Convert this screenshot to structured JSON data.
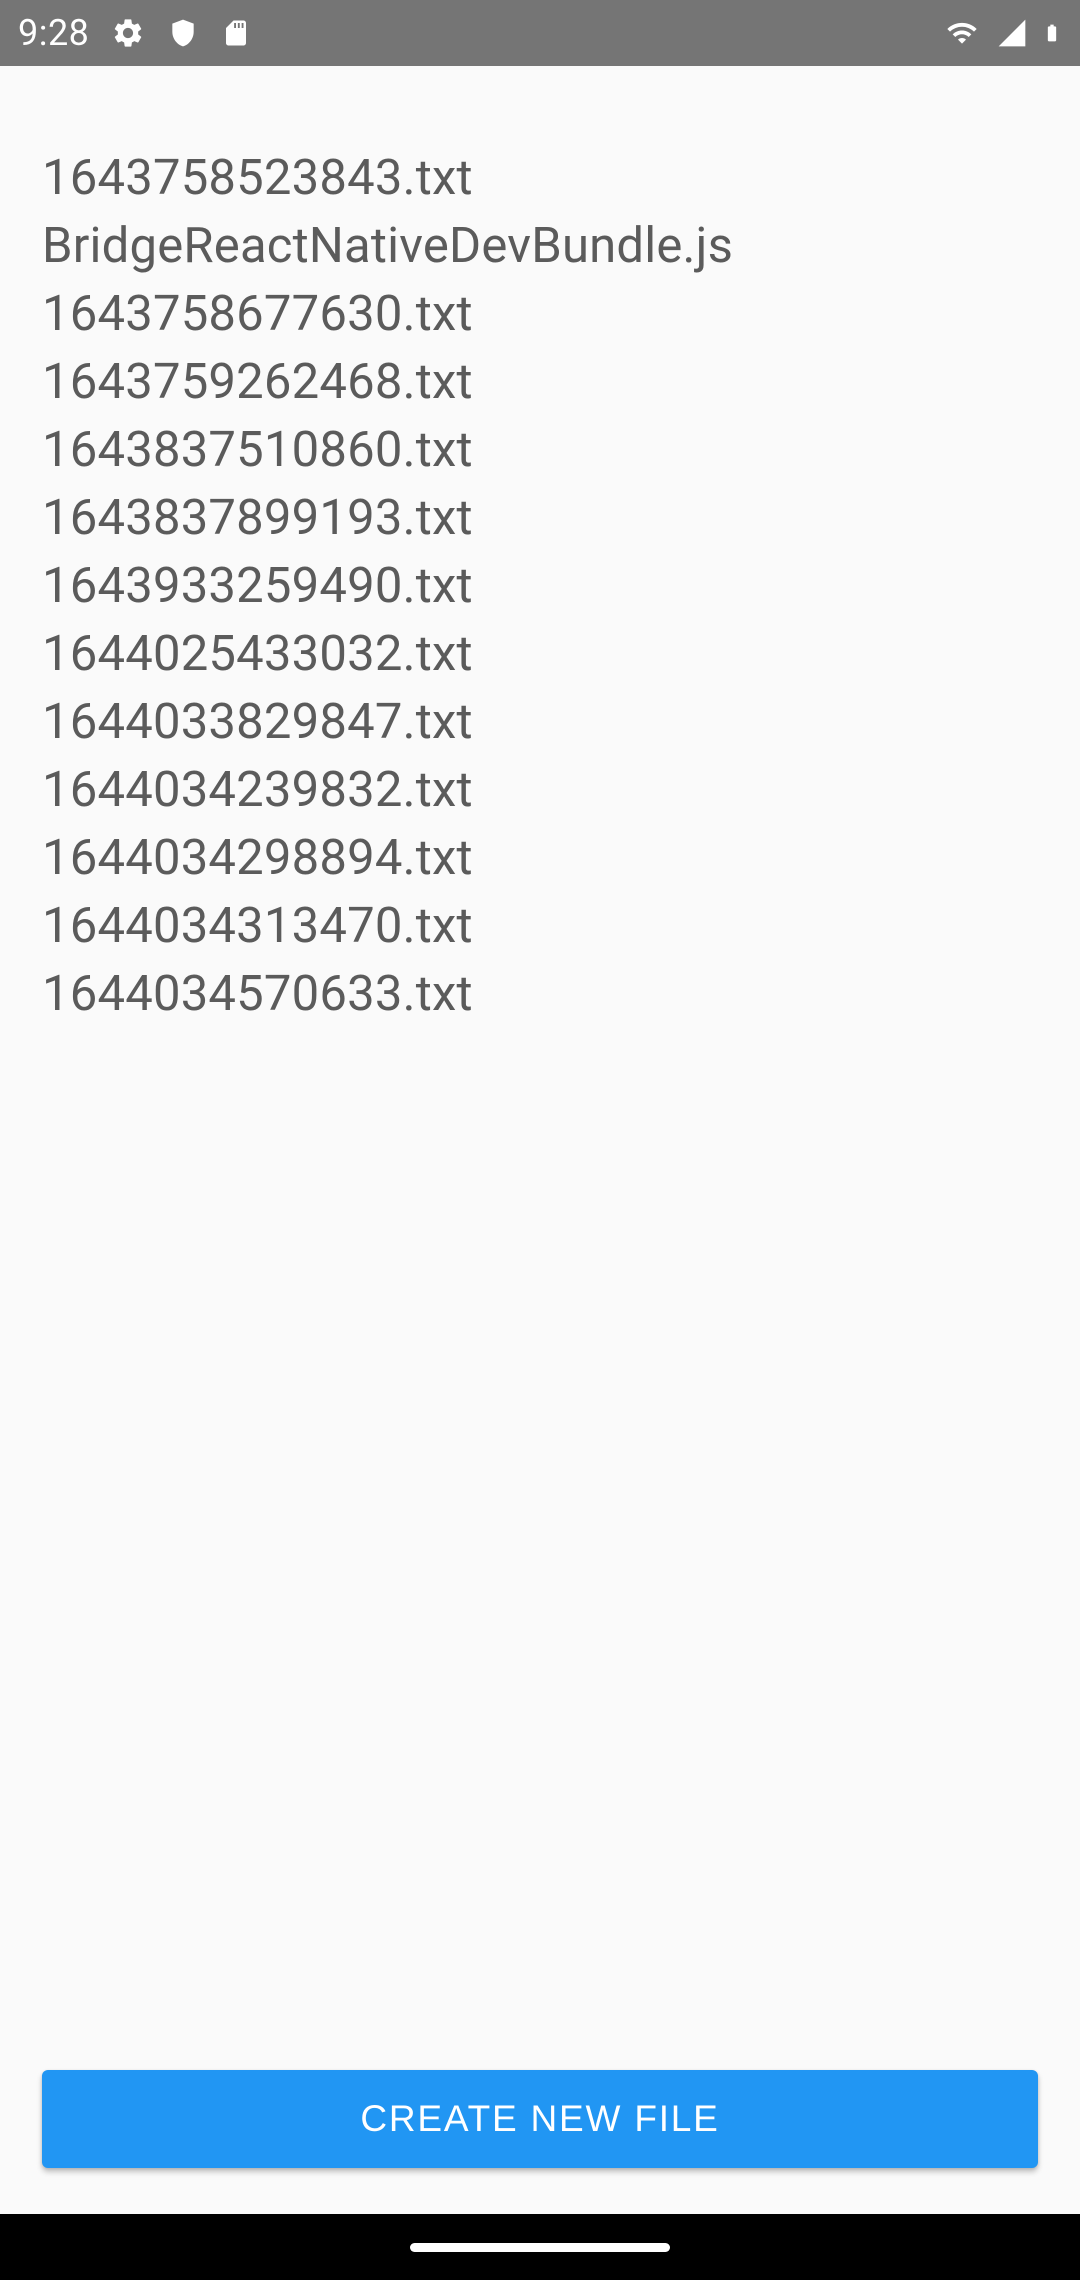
{
  "status_bar": {
    "time": "9:28"
  },
  "files": [
    "1643758523843.txt",
    "BridgeReactNativeDevBundle.js",
    "1643758677630.txt",
    "1643759262468.txt",
    "1643837510860.txt",
    "1643837899193.txt",
    "1643933259490.txt",
    "1644025433032.txt",
    "1644033829847.txt",
    "1644034239832.txt",
    "1644034298894.txt",
    "1644034313470.txt",
    "1644034570633.txt"
  ],
  "button": {
    "create_label": "CREATE NEW FILE"
  }
}
